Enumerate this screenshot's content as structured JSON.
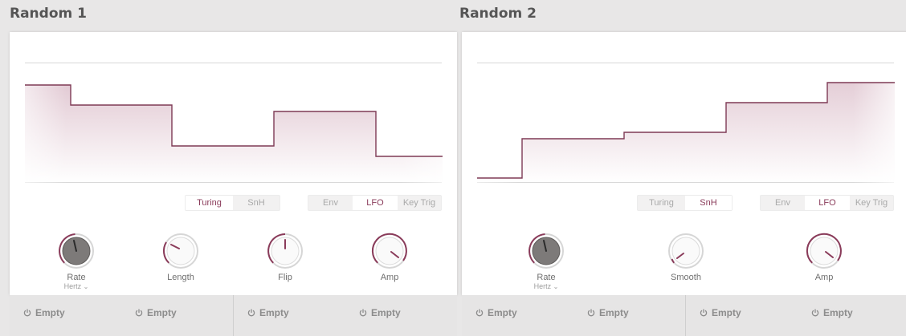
{
  "modules": [
    {
      "title": "Random 1",
      "mode_tabs": [
        {
          "label": "Turing",
          "active": true
        },
        {
          "label": "SnH",
          "active": false
        }
      ],
      "trigger_tabs": [
        {
          "label": "Env",
          "active": false
        },
        {
          "label": "LFO",
          "active": true
        },
        {
          "label": "Key Trig",
          "active": false
        }
      ],
      "knobs": [
        {
          "label": "Rate",
          "sub": "Hertz",
          "style": "dark"
        },
        {
          "label": "Length",
          "style": "light"
        },
        {
          "label": "Flip",
          "style": "light"
        },
        {
          "label": "Amp",
          "style": "light"
        }
      ],
      "slots": [
        "Empty",
        "Empty",
        "Empty",
        "Empty"
      ]
    },
    {
      "title": "Random 2",
      "mode_tabs": [
        {
          "label": "Turing",
          "active": false
        },
        {
          "label": "SnH",
          "active": true
        }
      ],
      "trigger_tabs": [
        {
          "label": "Env",
          "active": false
        },
        {
          "label": "LFO",
          "active": true
        },
        {
          "label": "Key Trig",
          "active": false
        }
      ],
      "knobs": [
        {
          "label": "Rate",
          "sub": "Hertz",
          "style": "dark"
        },
        {
          "label": "Smooth",
          "style": "light"
        },
        {
          "label": "Amp",
          "style": "light"
        }
      ],
      "slots": [
        "Empty",
        "Empty",
        "Empty",
        "Empty"
      ]
    }
  ],
  "colors": {
    "accent": "#8a3b5a",
    "fill": "#e9d3dc",
    "knob_dark": "#7b7877",
    "panel": "#ffffff",
    "strip": "#e6e5e5"
  }
}
